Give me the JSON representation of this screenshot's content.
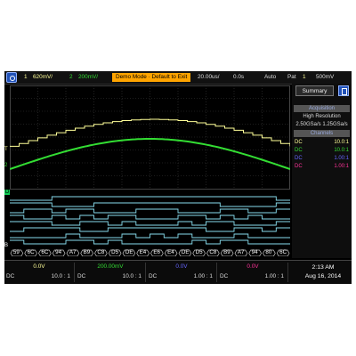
{
  "topbar": {
    "ch1_num": "1",
    "ch1_scale": "620mV/",
    "ch2_num": "2",
    "ch2_scale": "200mV/",
    "demo": "Demo Mode · Default to Exit",
    "timebase": "20.00us/",
    "delay": "0.0s",
    "trig_mode": "Auto",
    "pat": "Pat",
    "trig_ch": "1",
    "trig_level": "500mV"
  },
  "side": {
    "tab": "Summary",
    "acq_header": "Acquisition",
    "acq_mode": "High Resolution",
    "acq_rate": "2.50GSa/s  1.25GSa/s",
    "channels_header": "Channels",
    "rows": [
      {
        "coupling": "DC",
        "probe": "10.0:1",
        "color": "#ffff99"
      },
      {
        "coupling": "DC",
        "probe": "10.0:1",
        "color": "#33dd33"
      },
      {
        "coupling": "DC",
        "probe": "1.00:1",
        "color": "#6666ff"
      },
      {
        "coupling": "DC",
        "probe": "1.00:1",
        "color": "#ff3399"
      }
    ]
  },
  "bus_values": [
    "59",
    "6C",
    "6C",
    "94",
    "A7",
    "B9",
    "C8",
    "D5",
    "DE",
    "E4",
    "E6",
    "E4",
    "DE",
    "D5",
    "C8",
    "B9",
    "A7",
    "94",
    "80",
    "6C"
  ],
  "bottom": {
    "channels": [
      {
        "offset": "0.0V",
        "coupling": "DC",
        "probe": "10.0 : 1",
        "color": "#ffff99"
      },
      {
        "offset": "200.00mV",
        "coupling": "DC",
        "probe": "10.0 : 1",
        "color": "#33dd33"
      },
      {
        "offset": "0.0V",
        "coupling": "DC",
        "probe": "1.00 : 1",
        "color": "#6666ff"
      },
      {
        "offset": "0.0V",
        "coupling": "DC",
        "probe": "1.00 : 1",
        "color": "#ff3399"
      }
    ],
    "time": "2:13 AM",
    "date": "Aug 16, 2014"
  },
  "colors": {
    "ch1": "#ffff99",
    "ch2": "#33dd33",
    "digital": "#88ddee",
    "accent": "#ffa400"
  }
}
